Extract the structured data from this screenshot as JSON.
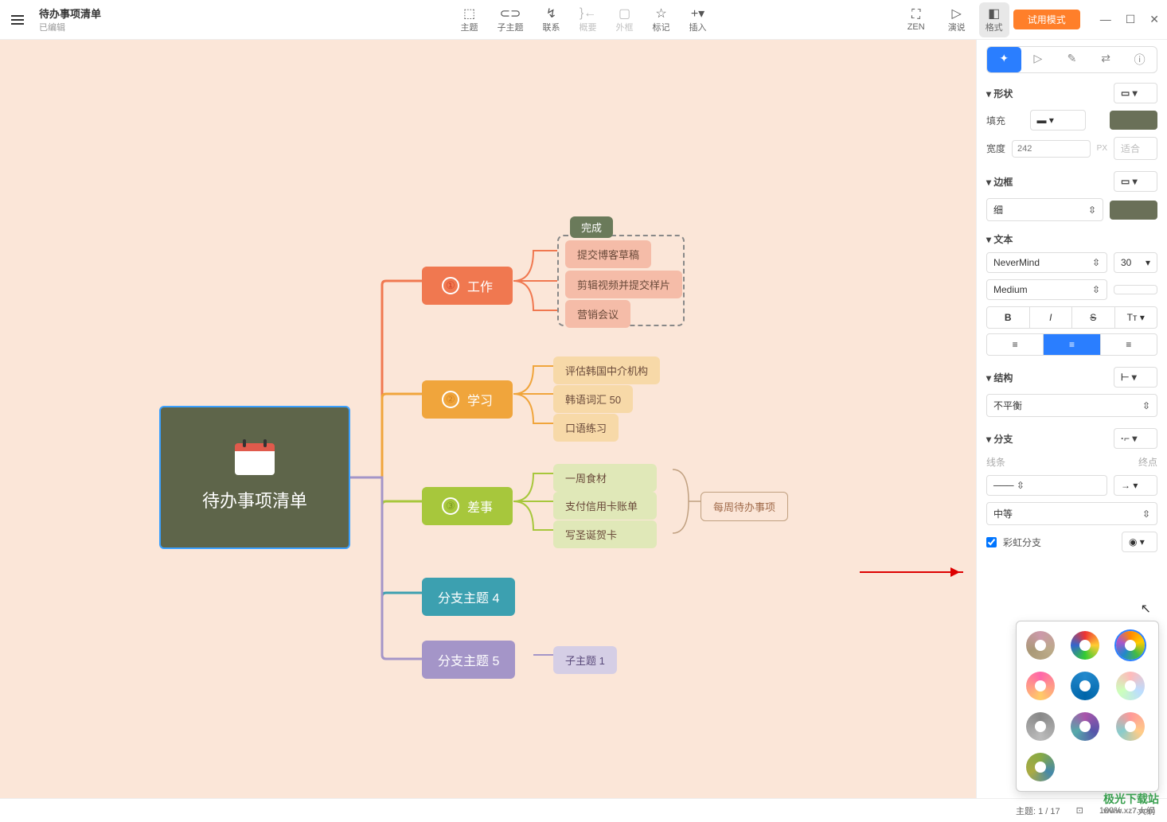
{
  "header": {
    "title": "待办事项清单",
    "status": "已编辑",
    "toolbar": [
      {
        "key": "topic",
        "label": "主题"
      },
      {
        "key": "subtopic",
        "label": "子主题"
      },
      {
        "key": "relation",
        "label": "联系"
      },
      {
        "key": "summary",
        "label": "概要"
      },
      {
        "key": "boundary",
        "label": "外框"
      },
      {
        "key": "marker",
        "label": "标记"
      },
      {
        "key": "insert",
        "label": "插入"
      }
    ],
    "right": {
      "zen": "ZEN",
      "present": "演说",
      "format": "格式",
      "trial": "试用模式"
    }
  },
  "mindmap": {
    "root": "待办事项清单",
    "branches": [
      {
        "num": "①",
        "label": "工作",
        "color": "work",
        "leaves": [
          "提交博客草稿",
          "剪辑视频并提交样片",
          "营销会议"
        ],
        "group_label": "完成"
      },
      {
        "num": "②",
        "label": "学习",
        "color": "study",
        "leaves": [
          "评估韩国中介机构",
          "韩语词汇 50",
          "口语练习"
        ]
      },
      {
        "num": "③",
        "label": "差事",
        "color": "task",
        "leaves": [
          "一周食材",
          "支付信用卡账单",
          "写圣诞贺卡"
        ],
        "summary": "每周待办事项"
      },
      {
        "label": "分支主题 4"
      },
      {
        "label": "分支主题 5",
        "leaves": [
          "子主题 1"
        ]
      }
    ]
  },
  "panel": {
    "sections": {
      "shape": "形状",
      "fill": "填充",
      "width": "宽度",
      "width_val": "242",
      "width_unit": "PX",
      "width_btn": "适合",
      "border": "边框",
      "border_style": "细",
      "text": "文本",
      "font": "NeverMind",
      "size": "30",
      "weight": "Medium",
      "structure": "结构",
      "structure_val": "不平衡",
      "branch": "分支",
      "line": "线条",
      "end": "终点",
      "thickness": "中等",
      "rainbow": "彩虹分支"
    }
  },
  "statusbar": {
    "topic": "主题: 1 / 17",
    "zoom": "100%",
    "outline": "大纲"
  },
  "watermark": {
    "name": "极光下载站",
    "url": "www.xz7.com"
  }
}
